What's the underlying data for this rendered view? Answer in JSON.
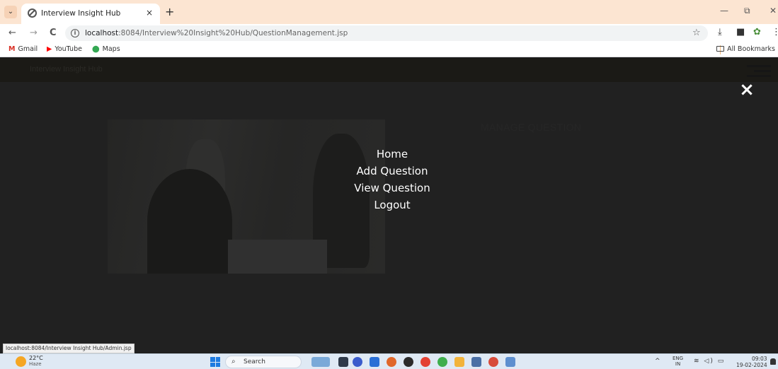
{
  "browser": {
    "tab": {
      "title": "Interview Insight Hub",
      "close": "×"
    },
    "new_tab": "+",
    "window_controls": {
      "minimize": "—",
      "restore": "⧉",
      "close": "✕"
    },
    "nav": {
      "back": "←",
      "forward": "→",
      "reload": "C"
    },
    "url_host": "localhost",
    "url_rest": ":8084/Interview%20Insight%20Hub/QuestionManagement.jsp",
    "bookmarks": [
      {
        "icon": "M",
        "label": "Gmail",
        "color": "#d93025"
      },
      {
        "icon": "▶",
        "label": "YouTube",
        "color": "#ff0000"
      },
      {
        "icon": "⬤",
        "label": "Maps",
        "color": "#34a853"
      }
    ],
    "all_bookmarks": "All Bookmarks"
  },
  "page": {
    "brand": "Interview Insight Hub",
    "manage_title": "MANAGE QUESTION",
    "overlay": {
      "close": "×",
      "menu": [
        "Home",
        "Add Question",
        "View Question",
        "Logout"
      ]
    }
  },
  "status_url": "localhost:8084/Interview Insight Hub/Admin.jsp",
  "taskbar": {
    "weather_temp": "22°C",
    "weather_desc": "Haze",
    "search_label": "Search",
    "lang_top": "ENG",
    "lang_bottom": "IN",
    "time": "09:03",
    "date": "19-02-2024"
  },
  "colors": {
    "tabstrip": "#fce5d2",
    "viewport": "#212121",
    "overlay_text": "#ffffff",
    "taskbar": "#dfe9f4"
  }
}
